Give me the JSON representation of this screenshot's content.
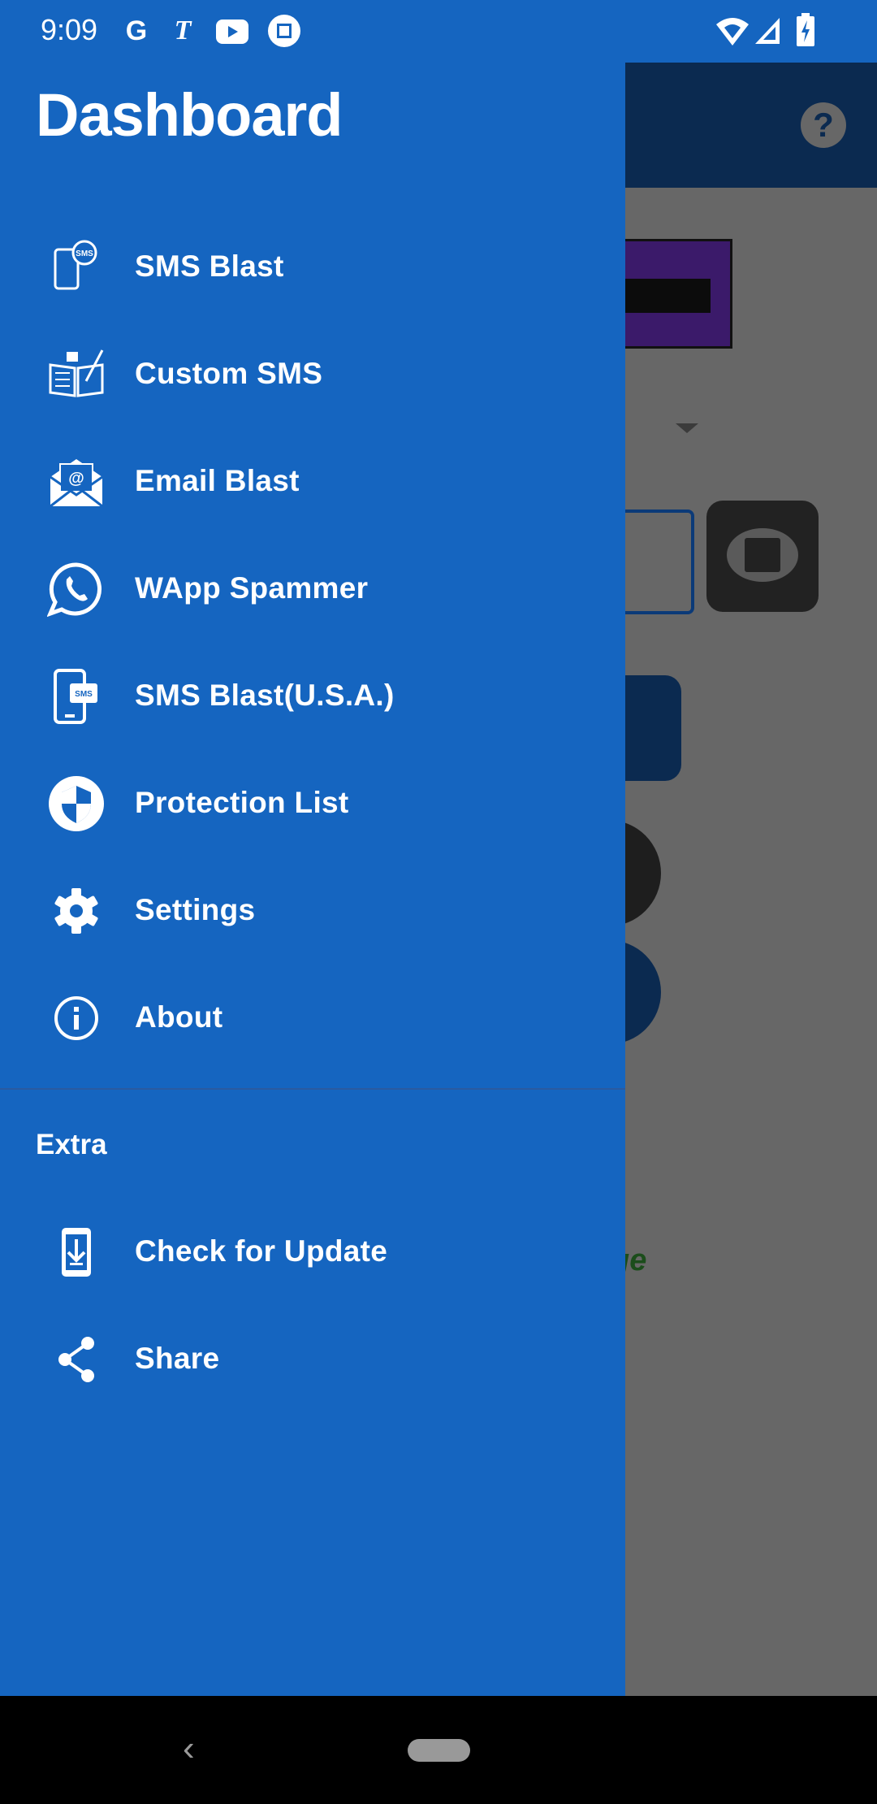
{
  "status_bar": {
    "time": "9:09",
    "icons": [
      "google-icon",
      "notification-t-icon",
      "youtube-icon",
      "screenshot-icon",
      "wifi-icon",
      "signal-icon",
      "battery-charging-icon"
    ]
  },
  "drawer": {
    "title": "Dashboard",
    "items": [
      {
        "label": "SMS Blast",
        "icon": "sms-phone-icon"
      },
      {
        "label": "Custom SMS",
        "icon": "custom-sms-book-icon"
      },
      {
        "label": "Email Blast",
        "icon": "email-envelope-icon"
      },
      {
        "label": "WApp Spammer",
        "icon": "whatsapp-icon"
      },
      {
        "label": "SMS Blast(U.S.A.)",
        "icon": "sms-mobile-icon"
      },
      {
        "label": "Protection List",
        "icon": "shield-icon"
      },
      {
        "label": "Settings",
        "icon": "gear-icon"
      },
      {
        "label": "About",
        "icon": "info-icon"
      }
    ],
    "section_label": "Extra",
    "extra_items": [
      {
        "label": "Check for Update",
        "icon": "download-phone-icon"
      },
      {
        "label": "Share",
        "icon": "share-icon"
      }
    ]
  },
  "background": {
    "partial_text": "ge",
    "help": "?"
  },
  "colors": {
    "drawer": "#1565c0",
    "appbar": "#0b2a50",
    "scrim": "#676767"
  }
}
